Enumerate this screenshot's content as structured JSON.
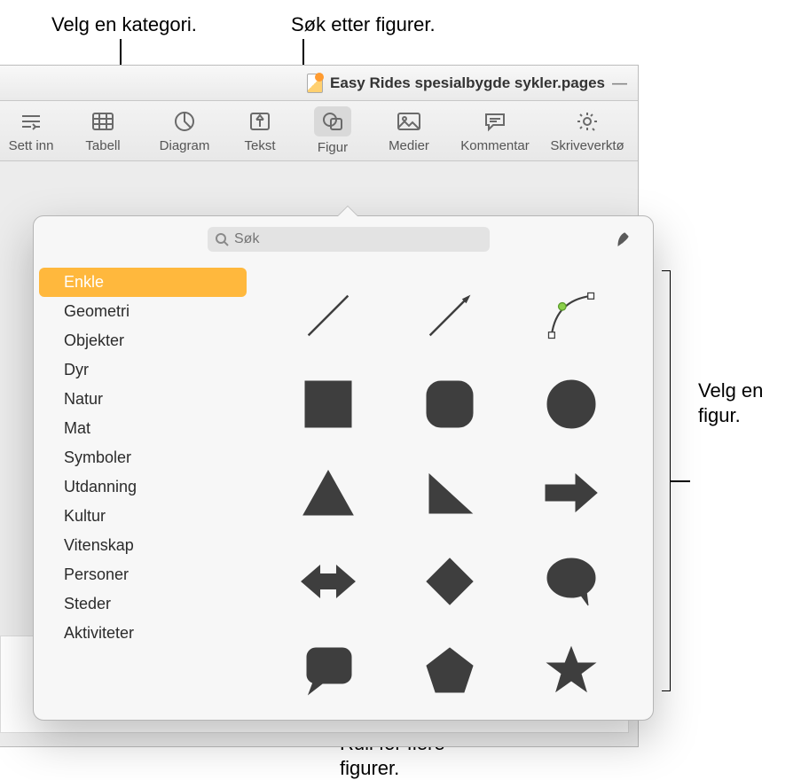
{
  "callouts": {
    "choose_category": "Velg en kategori.",
    "search_shapes": "Søk etter figurer.",
    "choose_shape_l1": "Velg en",
    "choose_shape_l2": "figur.",
    "scroll_more_l1": "Rull for flere",
    "scroll_more_l2": "figurer."
  },
  "title": {
    "document": "Easy Rides spesialbygde sykler.pages",
    "dash": "—"
  },
  "toolbar": {
    "insert": "Sett inn",
    "table": "Tabell",
    "chart": "Diagram",
    "text": "Tekst",
    "shape": "Figur",
    "media": "Medier",
    "comment": "Kommentar",
    "writing": "Skriveverktø"
  },
  "search": {
    "placeholder": "Søk"
  },
  "categories": [
    "Enkle",
    "Geometri",
    "Objekter",
    "Dyr",
    "Natur",
    "Mat",
    "Symboler",
    "Utdanning",
    "Kultur",
    "Vitenskap",
    "Personer",
    "Steder",
    "Aktiviteter"
  ],
  "selected_category_index": 0,
  "shapes": [
    "line",
    "arrow-line",
    "curve-pen",
    "square",
    "rounded-square",
    "circle",
    "triangle",
    "right-triangle",
    "arrow-right",
    "arrow-both",
    "diamond",
    "speech-bubble",
    "callout-square",
    "pentagon",
    "star"
  ]
}
